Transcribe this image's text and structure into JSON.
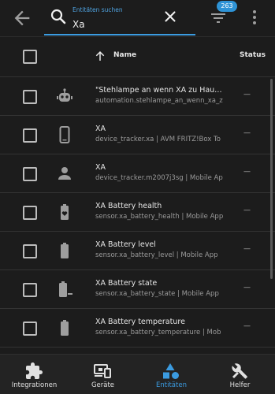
{
  "topbar": {
    "back_icon": "arrow-left-icon",
    "search_icon": "magnify-icon",
    "search_label": "Entitäten suchen",
    "search_value": "Xa",
    "clear_icon": "close-icon",
    "filter_icon": "filter-variant-icon",
    "filter_count": "263",
    "more_icon": "dots-vertical-icon",
    "accent_color": "#3b9be0"
  },
  "table": {
    "column_name": "Name",
    "column_status": "Status",
    "sort_icon": "arrow-up-icon",
    "rows": [
      {
        "icon": "robot-icon",
        "title": "\"Stehlampe an wenn XA zu Hau…",
        "subtitle": "automation.stehlampe_an_wenn_xa_z",
        "status": "—"
      },
      {
        "icon": "cellphone-icon",
        "title": "XA",
        "subtitle": "device_tracker.xa | AVM FRITZ!Box To",
        "status": "—"
      },
      {
        "icon": "account-icon",
        "title": "XA",
        "subtitle": "device_tracker.m2007j3sg | Mobile App",
        "status": "—"
      },
      {
        "icon": "battery-heart-icon",
        "title": "XA Battery health",
        "subtitle": "sensor.xa_battery_health | Mobile App",
        "status": "—"
      },
      {
        "icon": "battery-icon",
        "title": "XA Battery level",
        "subtitle": "sensor.xa_battery_level | Mobile App",
        "status": "—"
      },
      {
        "icon": "battery-minus-icon",
        "title": "XA Battery state",
        "subtitle": "sensor.xa_battery_state | Mobile App",
        "status": "—"
      },
      {
        "icon": "battery-temperature-icon",
        "title": "XA Battery temperature",
        "subtitle": "sensor.xa_battery_temperature | Mob",
        "status": "—"
      }
    ]
  },
  "bottomnav": {
    "items": [
      {
        "label": "Integrationen",
        "icon": "puzzle-icon"
      },
      {
        "label": "Geräte",
        "icon": "devices-icon"
      },
      {
        "label": "Entitäten",
        "icon": "shape-icon"
      },
      {
        "label": "Helfer",
        "icon": "tools-icon"
      }
    ]
  }
}
